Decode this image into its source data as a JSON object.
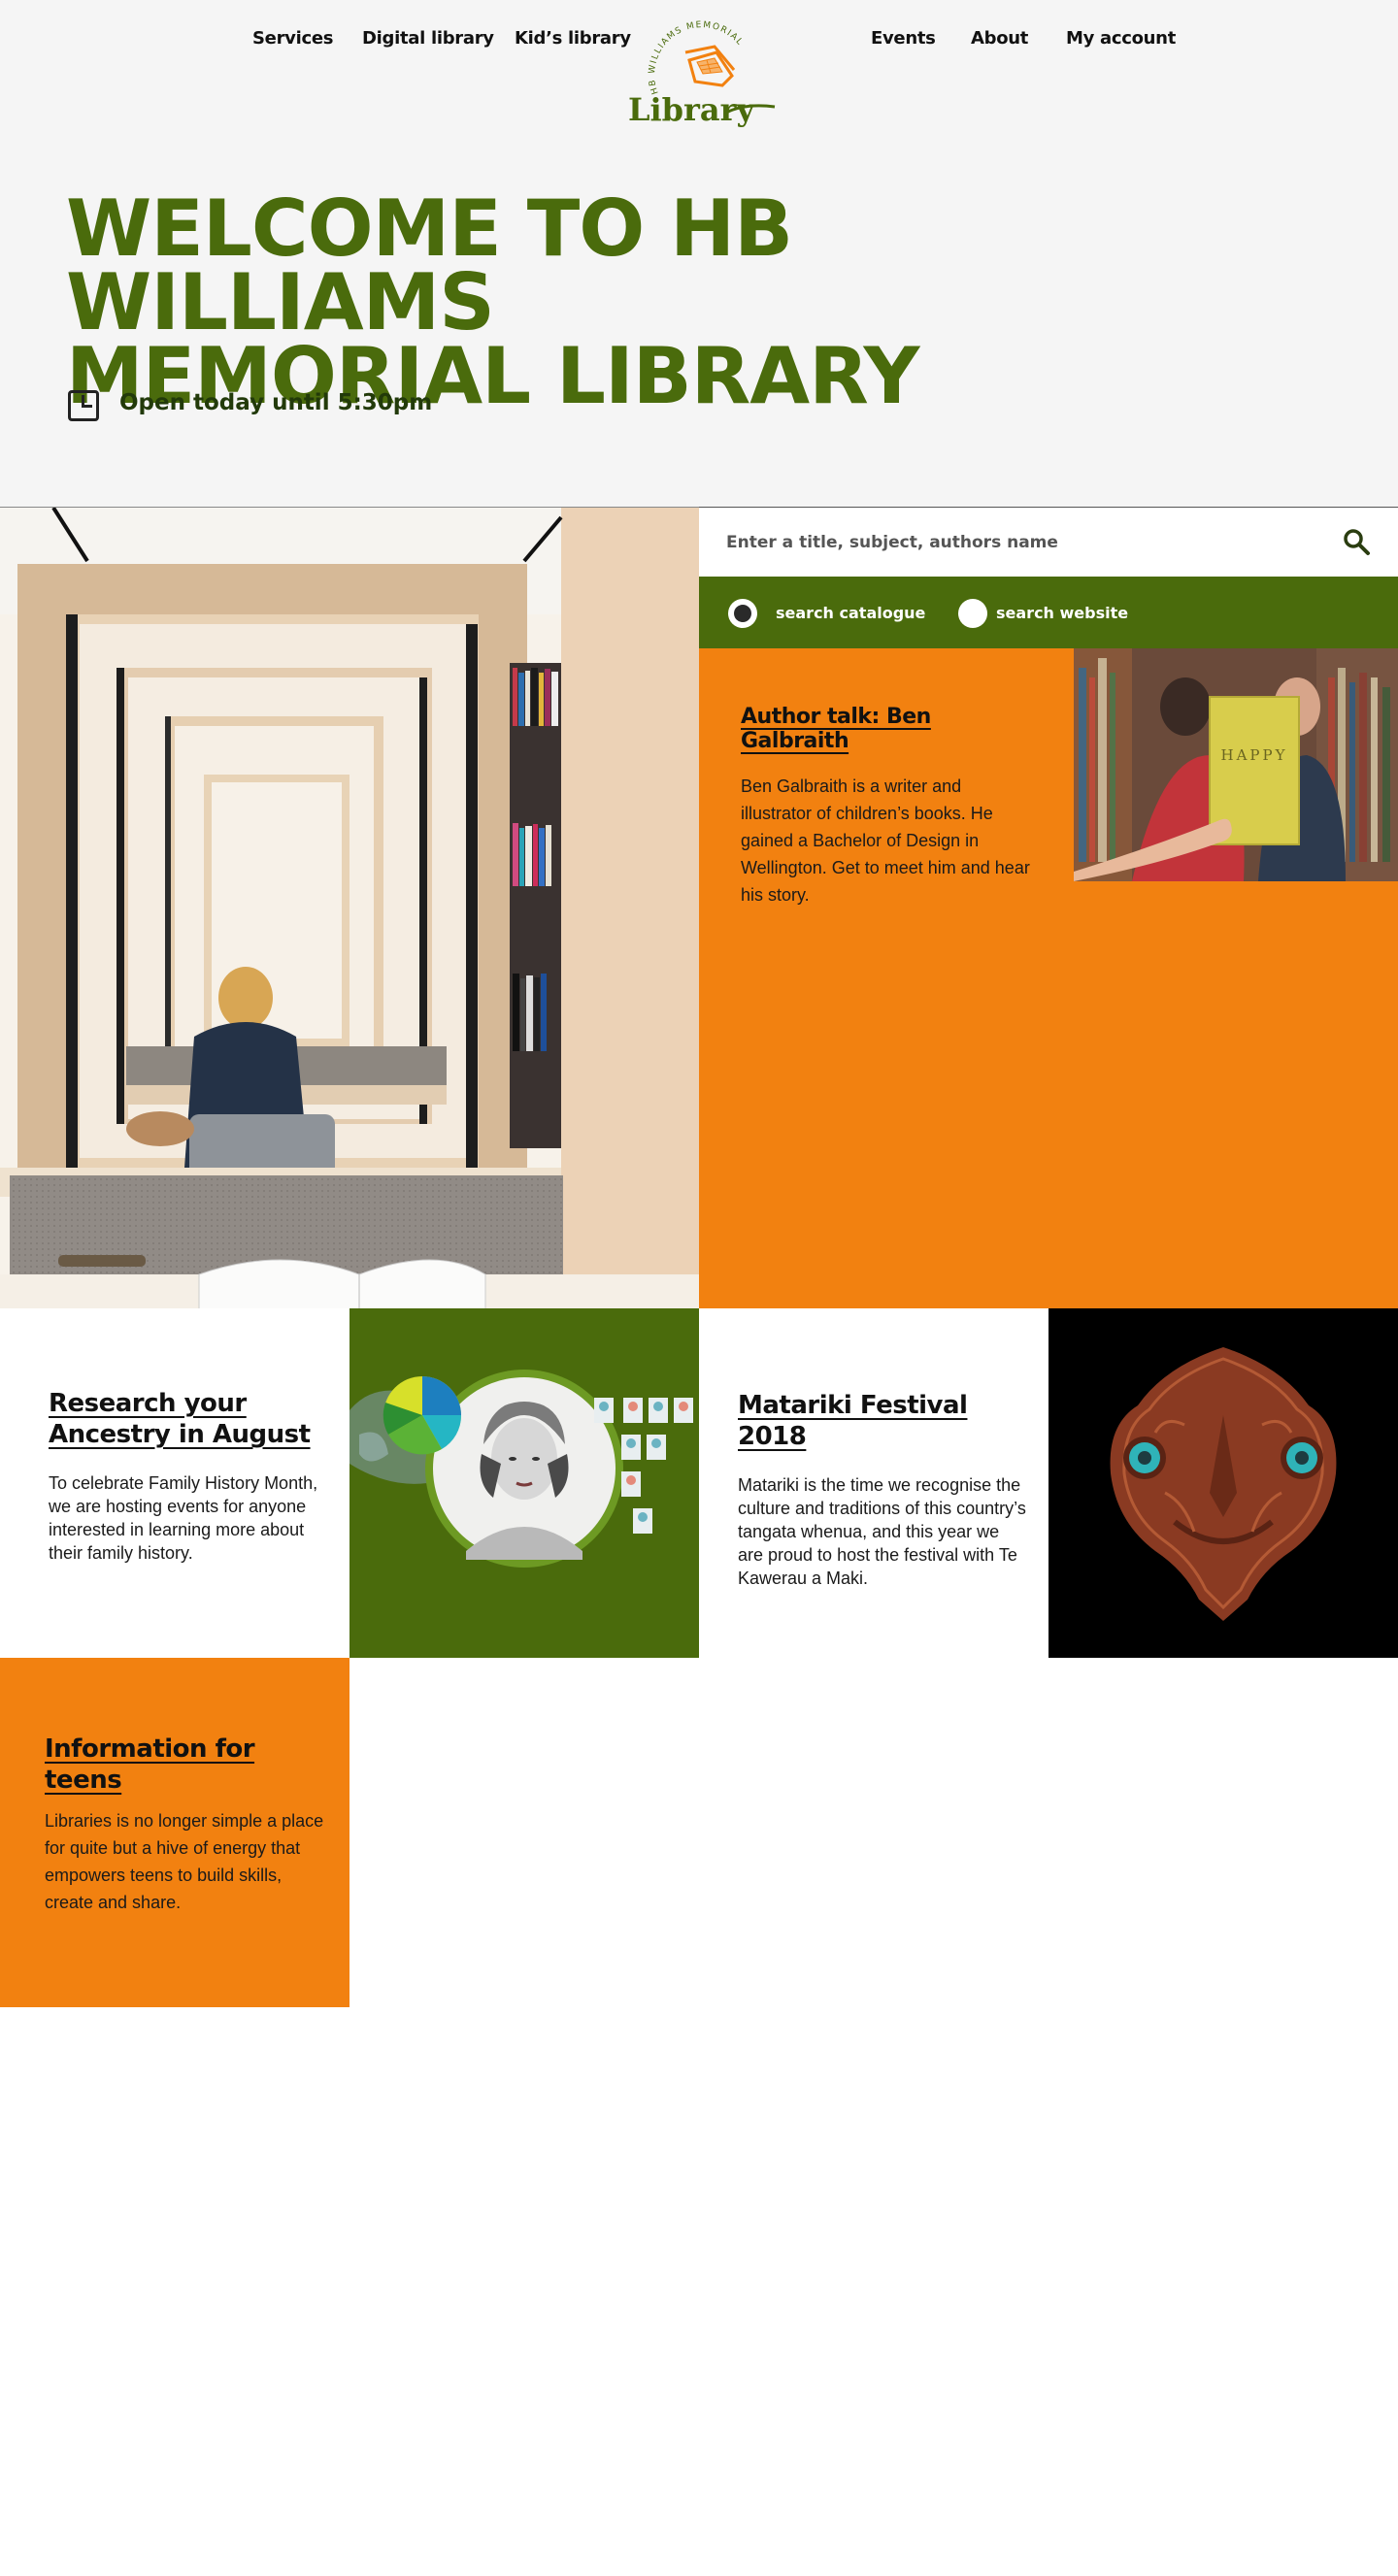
{
  "nav": {
    "left": [
      "Services",
      "Digital library",
      "Kid’s library"
    ],
    "right": [
      "Events",
      "About",
      "My account"
    ]
  },
  "logo": {
    "arc_text": "HB WILLIAMS MEMORIAL",
    "word": "Library"
  },
  "hero": {
    "title_line1": "WELCOME TO HB WILLIAMS",
    "title_line2": "MEMORIAL LIBRARY",
    "hours": "Open today until 5:30pm",
    "hours_icon": "clock-icon"
  },
  "search": {
    "placeholder": "Enter a title, subject, authors name",
    "icon": "search-icon",
    "options": [
      "search catalogue",
      "search website"
    ],
    "selected": "search catalogue"
  },
  "cards": {
    "author": {
      "title": "Author talk: Ben Galbraith",
      "body": "Ben Galbraith is a writer and illustrator of children’s books. He gained a Bachelor of Design in Wellington. Get to meet him and hear his story.",
      "book_title": "HAPPY"
    },
    "research": {
      "title": "Research your Ancestry in August",
      "body": "To celebrate Family History Month, we are hosting events for anyone interested in learning more about their family history."
    },
    "matariki": {
      "title": "Matariki Festival 2018",
      "body": "Matariki is the time we recognise the culture and traditions of this country’s tangata whenua, and this year we are proud to host the festival with Te Kawerau a Maki."
    },
    "teens": {
      "title": "Information for teens",
      "body": "Libraries is no longer simple a place for quite but a hive of energy that empowers teens to build skills, create and share."
    }
  },
  "colors": {
    "brand_green": "#4a6b0c",
    "brand_orange": "#f28110",
    "header_bg": "#f5f5f5"
  }
}
